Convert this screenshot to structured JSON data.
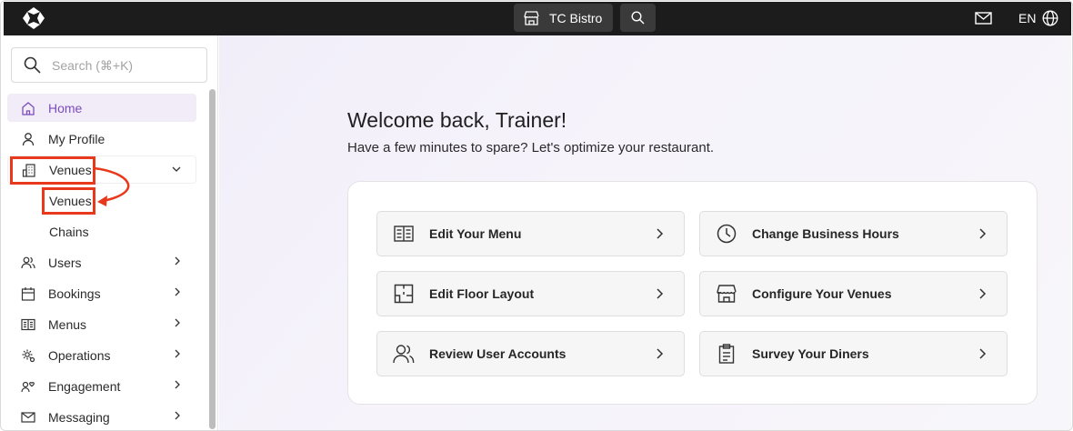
{
  "topbar": {
    "venue_name": "TC Bistro",
    "language": "EN"
  },
  "sidebar": {
    "search_placeholder": "Search (⌘+K)",
    "items": [
      {
        "label": "Home",
        "icon": "home-icon",
        "active": true
      },
      {
        "label": "My Profile",
        "icon": "user-icon"
      },
      {
        "label": "Venues",
        "icon": "building-icon",
        "expanded": true,
        "children": [
          {
            "label": "Venues"
          },
          {
            "label": "Chains"
          }
        ]
      },
      {
        "label": "Users",
        "icon": "users-icon"
      },
      {
        "label": "Bookings",
        "icon": "calendar-icon"
      },
      {
        "label": "Menus",
        "icon": "menu-book-icon"
      },
      {
        "label": "Operations",
        "icon": "operations-icon"
      },
      {
        "label": "Engagement",
        "icon": "engagement-icon"
      },
      {
        "label": "Messaging",
        "icon": "mail-icon"
      }
    ]
  },
  "main": {
    "welcome": "Welcome back, Trainer!",
    "subtitle": "Have a few minutes to spare? Let's optimize your restaurant.",
    "actions": [
      {
        "label": "Edit Your Menu",
        "icon": "open-book-icon"
      },
      {
        "label": "Change Business Hours",
        "icon": "clock-icon"
      },
      {
        "label": "Edit Floor Layout",
        "icon": "floor-plan-icon"
      },
      {
        "label": "Configure Your Venues",
        "icon": "storefront-icon"
      },
      {
        "label": "Review User Accounts",
        "icon": "users-icon"
      },
      {
        "label": "Survey Your Diners",
        "icon": "clipboard-icon"
      }
    ]
  },
  "colors": {
    "accent": "#7c4dbd",
    "annotation": "#e8391d",
    "topbar": "#1c1c1c"
  }
}
